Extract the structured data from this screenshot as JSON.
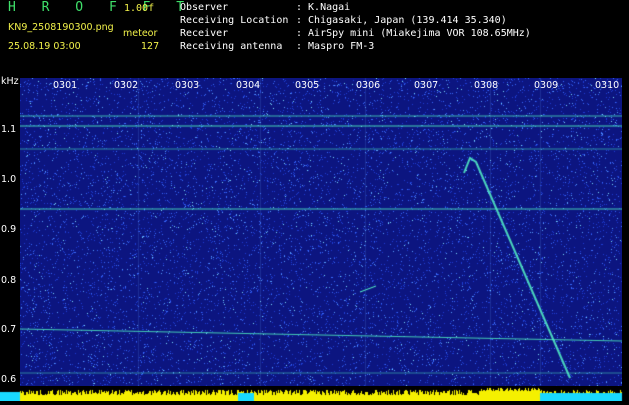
{
  "header": {
    "app_title": "H R O F F T",
    "version": "1.00f",
    "filename": "KN9_2508190300.png",
    "mode": "meteor",
    "datetime": "25.08.19 03:00",
    "count": "127",
    "info": [
      {
        "key": "Observer",
        "value": ": K.Nagai"
      },
      {
        "key": "Receiving Location",
        "value": ": Chigasaki, Japan (139.414 35.340)"
      },
      {
        "key": "Receiver",
        "value": ": AirSpy mini (Miakejima VOR 108.65MHz)"
      },
      {
        "key": "Receiving antenna",
        "value": ": Maspro FM-3"
      }
    ]
  },
  "axis": {
    "unit": "kHz",
    "y_ticks": [
      "1.1",
      "1.0",
      "0.9",
      "0.8",
      "0.7",
      "0.6"
    ],
    "x_ticks": [
      "0301",
      "0302",
      "0303",
      "0304",
      "0305",
      "0306",
      "0307",
      "0308",
      "0309",
      "0310"
    ]
  },
  "colors": {
    "background": "#0c1580",
    "noise": "#3a6cff",
    "signal": "#4ff0c0",
    "header_green": "#3fe06a",
    "header_yellow": "#f2f24a",
    "spectrum_yellow": "#f5f000",
    "spectrum_cyan": "#19d9ff"
  }
}
